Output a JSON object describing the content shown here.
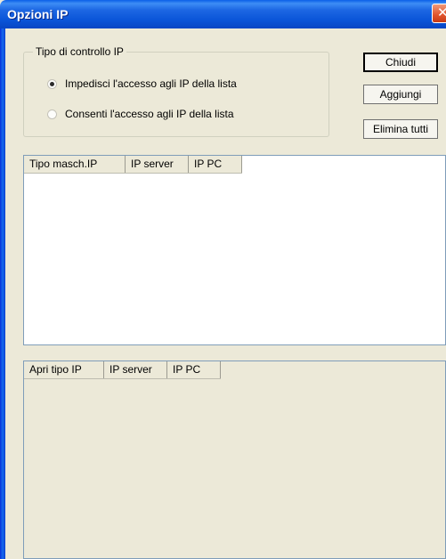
{
  "window": {
    "title": "Opzioni IP"
  },
  "group": {
    "legend": "Tipo di controllo IP",
    "options": [
      {
        "label": "Impedisci l'accesso agli IP della lista",
        "selected": true
      },
      {
        "label": "Consenti l'accesso agli IP della lista",
        "selected": false
      }
    ]
  },
  "buttons": {
    "close": "Chiudi",
    "add": "Aggiungi",
    "delete_all": "Elimina tutti"
  },
  "list_top": {
    "columns": [
      "Tipo masch.IP",
      "IP server",
      "IP PC"
    ]
  },
  "list_bottom": {
    "columns": [
      "Apri tipo IP",
      "IP server",
      "IP PC"
    ]
  },
  "icons": {
    "close": "close-icon",
    "radio": "radio-icon"
  },
  "colors": {
    "titlebar": "#0a55d8",
    "face": "#ece9d8",
    "close": "#e0542c"
  }
}
